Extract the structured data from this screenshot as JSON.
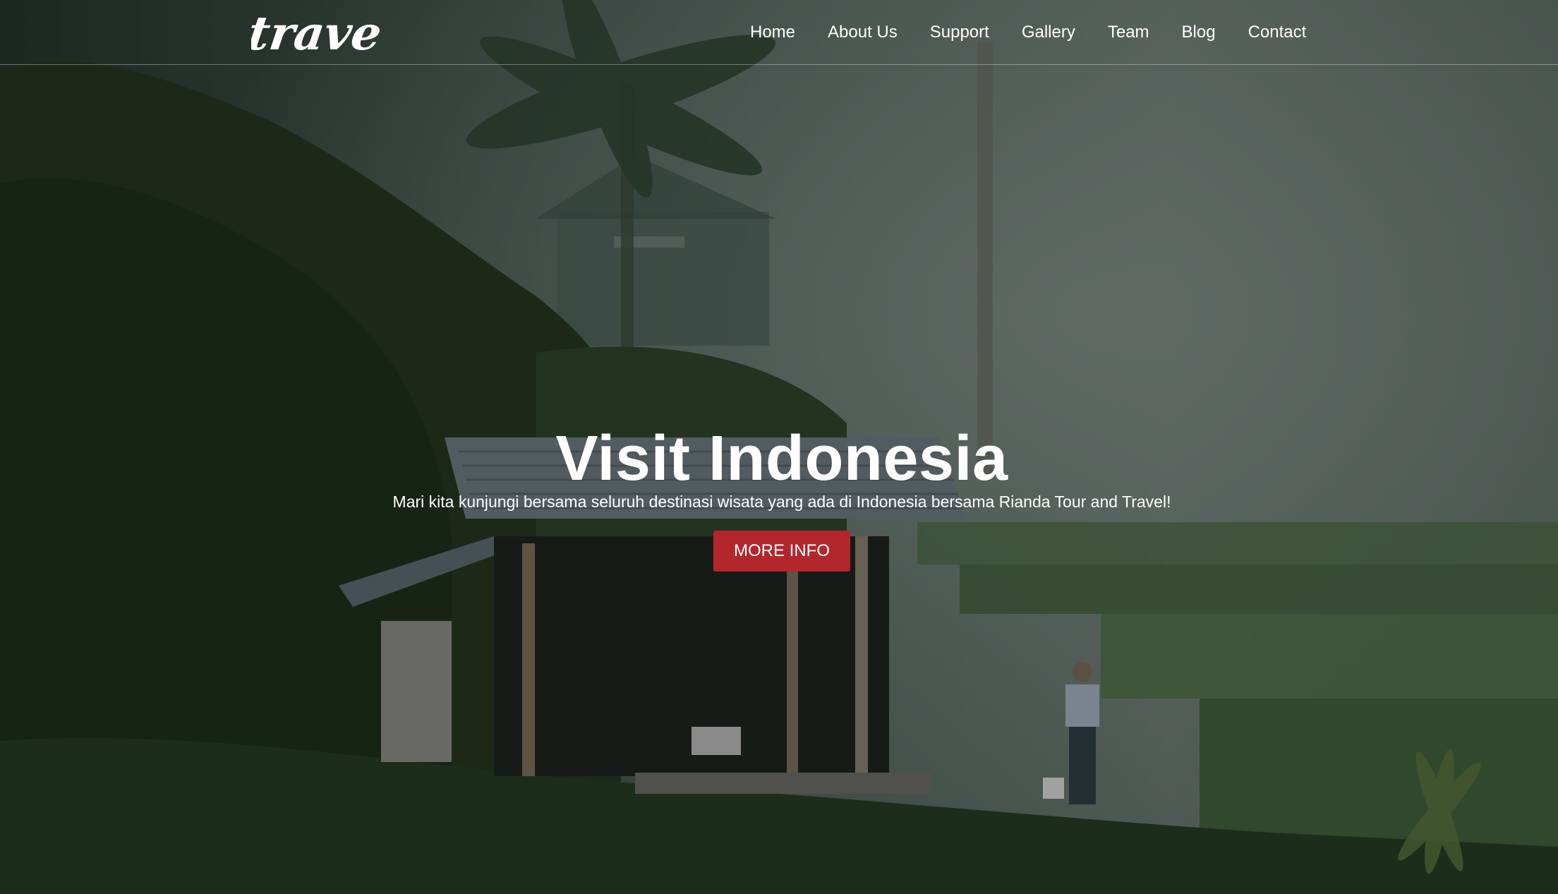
{
  "brand": {
    "logo_text": "travel"
  },
  "nav": {
    "items": [
      {
        "label": "Home"
      },
      {
        "label": "About Us"
      },
      {
        "label": "Support"
      },
      {
        "label": "Gallery"
      },
      {
        "label": "Team"
      },
      {
        "label": "Blog"
      },
      {
        "label": "Contact"
      }
    ]
  },
  "hero": {
    "title": "Visit Indonesia",
    "subtitle": "Mari kita kunjungi bersama seluruh destinasi wisata yang ada di Indonesia bersama Rianda Tour and Travel!",
    "cta_label": "MORE INFO",
    "background_description_icon": "rice-terrace-hut-photo"
  },
  "colors": {
    "accent": "#b3262b",
    "text": "#ffffff"
  }
}
